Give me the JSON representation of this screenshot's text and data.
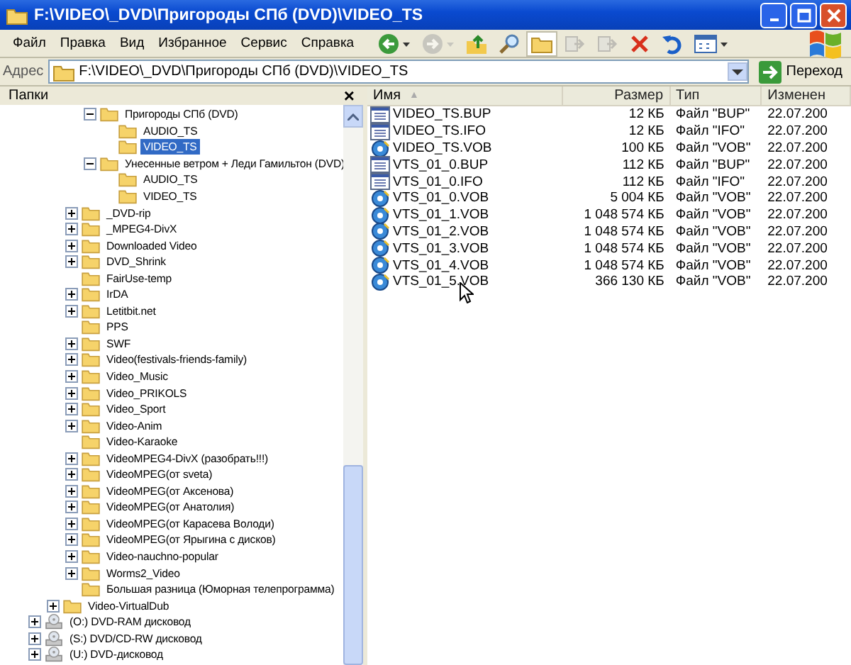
{
  "window": {
    "title": "F:\\VIDEO\\_DVD\\Пригороды СПб (DVD)\\VIDEO_TS"
  },
  "menu": [
    "Файл",
    "Правка",
    "Вид",
    "Избранное",
    "Сервис",
    "Справка"
  ],
  "toolbar": [
    {
      "kind": "back",
      "disabled": false,
      "pressed": false
    },
    {
      "kind": "forward",
      "disabled": true,
      "pressed": false
    },
    {
      "kind": "up",
      "disabled": false,
      "pressed": false
    },
    {
      "kind": "search",
      "disabled": false,
      "pressed": false
    },
    {
      "kind": "folders",
      "disabled": false,
      "pressed": true
    },
    {
      "kind": "move",
      "disabled": true,
      "pressed": false
    },
    {
      "kind": "copy",
      "disabled": true,
      "pressed": false
    },
    {
      "kind": "delete",
      "disabled": false,
      "pressed": false
    },
    {
      "kind": "undo",
      "disabled": false,
      "pressed": false
    },
    {
      "kind": "views",
      "disabled": false,
      "pressed": false
    }
  ],
  "address": {
    "label": "Адрес",
    "value": "F:\\VIDEO\\_DVD\\Пригороды СПб (DVD)\\VIDEO_TS",
    "go": "Переход"
  },
  "folders_pane": {
    "title": "Папки",
    "close": "×",
    "tree": [
      {
        "children": [
          {
            "children": [
              {
                "children": [
                  {
                    "label": "Пригороды СПб (DVD)",
                    "kind": "folder",
                    "expandable": true,
                    "expanded": true,
                    "selected": false,
                    "children": [
                      {
                        "label": "AUDIO_TS",
                        "kind": "folder",
                        "expandable": false,
                        "selected": false
                      },
                      {
                        "label": "VIDEO_TS",
                        "kind": "folder",
                        "expandable": false,
                        "selected": true
                      }
                    ]
                  },
                  {
                    "label": "Унесенные ветром + Леди Гамильтон (DVD)",
                    "kind": "folder",
                    "expandable": true,
                    "expanded": true,
                    "selected": false,
                    "children": [
                      {
                        "label": "AUDIO_TS",
                        "kind": "folder",
                        "expandable": false,
                        "selected": false
                      },
                      {
                        "label": "VIDEO_TS",
                        "kind": "folder",
                        "expandable": false,
                        "selected": false
                      }
                    ]
                  }
                ]
              },
              {
                "label": "_DVD-rip",
                "kind": "folder",
                "expandable": true,
                "expanded": false,
                "selected": false
              },
              {
                "label": "_MPEG4-DivX",
                "kind": "folder",
                "expandable": true,
                "expanded": false,
                "selected": false
              },
              {
                "label": "Downloaded Video",
                "kind": "folder",
                "expandable": true,
                "expanded": false,
                "selected": false
              },
              {
                "label": "DVD_Shrink",
                "kind": "folder",
                "expandable": true,
                "expanded": false,
                "selected": false
              },
              {
                "label": "FairUse-temp",
                "kind": "folder",
                "expandable": false,
                "selected": false
              },
              {
                "label": "IrDA",
                "kind": "folder",
                "expandable": true,
                "expanded": false,
                "selected": false
              },
              {
                "label": "Letitbit.net",
                "kind": "folder",
                "expandable": true,
                "expanded": false,
                "selected": false
              },
              {
                "label": "PPS",
                "kind": "folder",
                "expandable": false,
                "selected": false
              },
              {
                "label": "SWF",
                "kind": "folder",
                "expandable": true,
                "expanded": false,
                "selected": false
              },
              {
                "label": "Video(festivals-friends-family)",
                "kind": "folder",
                "expandable": true,
                "expanded": false,
                "selected": false
              },
              {
                "label": "Video_Music",
                "kind": "folder",
                "expandable": true,
                "expanded": false,
                "selected": false
              },
              {
                "label": "Video_PRIKOLS",
                "kind": "folder",
                "expandable": true,
                "expanded": false,
                "selected": false
              },
              {
                "label": "Video_Sport",
                "kind": "folder",
                "expandable": true,
                "expanded": false,
                "selected": false
              },
              {
                "label": "Video-Anim",
                "kind": "folder",
                "expandable": true,
                "expanded": false,
                "selected": false
              },
              {
                "label": "Video-Karaoke",
                "kind": "folder",
                "expandable": false,
                "selected": false
              },
              {
                "label": "VideoMPEG4-DivX (разобрать!!!)",
                "kind": "folder",
                "expandable": true,
                "expanded": false,
                "selected": false
              },
              {
                "label": "VideoMPEG(от sveta)",
                "kind": "folder",
                "expandable": true,
                "expanded": false,
                "selected": false
              },
              {
                "label": "VideoMPEG(от Аксенова)",
                "kind": "folder",
                "expandable": true,
                "expanded": false,
                "selected": false
              },
              {
                "label": "VideoMPEG(от Анатолия)",
                "kind": "folder",
                "expandable": true,
                "expanded": false,
                "selected": false
              },
              {
                "label": "VideoMPEG(от Карасева Володи)",
                "kind": "folder",
                "expandable": true,
                "expanded": false,
                "selected": false
              },
              {
                "label": "VideoMPEG(от Ярыгина с дисков)",
                "kind": "folder",
                "expandable": true,
                "expanded": false,
                "selected": false
              },
              {
                "label": "Video-nauchno-popular",
                "kind": "folder",
                "expandable": true,
                "expanded": false,
                "selected": false
              },
              {
                "label": "Worms2_Video",
                "kind": "folder",
                "expandable": true,
                "expanded": false,
                "selected": false
              },
              {
                "label": "Большая разница (Юморная телепрограмма)",
                "kind": "folder",
                "expandable": false,
                "selected": false
              }
            ]
          },
          {
            "label": "Video-VirtualDub",
            "kind": "folder",
            "expandable": true,
            "expanded": false,
            "selected": false
          }
        ]
      },
      {
        "label": "(O:) DVD-RAM дисковод",
        "kind": "drive",
        "expandable": true,
        "expanded": false,
        "selected": false
      },
      {
        "label": "(S:) DVD/CD-RW дисковод",
        "kind": "drive",
        "expandable": true,
        "expanded": false,
        "selected": false
      },
      {
        "label": "(U:) DVD-дисковод",
        "kind": "drive",
        "expandable": true,
        "expanded": false,
        "selected": false
      }
    ]
  },
  "file_list": {
    "columns": [
      {
        "label": "Имя",
        "sorted": true
      },
      {
        "label": "Размер",
        "sorted": false
      },
      {
        "label": "Тип",
        "sorted": false
      },
      {
        "label": "Изменен",
        "sorted": false
      }
    ],
    "sort_arrow": "▲",
    "rows": [
      {
        "kind": "data",
        "name": "VIDEO_TS.BUP",
        "size": "12 КБ",
        "type": "Файл \"BUP\"",
        "modified": "22.07.200"
      },
      {
        "kind": "data",
        "name": "VIDEO_TS.IFO",
        "size": "12 КБ",
        "type": "Файл \"IFO\"",
        "modified": "22.07.200"
      },
      {
        "kind": "video",
        "name": "VIDEO_TS.VOB",
        "size": "100 КБ",
        "type": "Файл \"VOB\"",
        "modified": "22.07.200"
      },
      {
        "kind": "data",
        "name": "VTS_01_0.BUP",
        "size": "112 КБ",
        "type": "Файл \"BUP\"",
        "modified": "22.07.200"
      },
      {
        "kind": "data",
        "name": "VTS_01_0.IFO",
        "size": "112 КБ",
        "type": "Файл \"IFO\"",
        "modified": "22.07.200"
      },
      {
        "kind": "video",
        "name": "VTS_01_0.VOB",
        "size": "5 004 КБ",
        "type": "Файл \"VOB\"",
        "modified": "22.07.200"
      },
      {
        "kind": "video",
        "name": "VTS_01_1.VOB",
        "size": "1 048 574 КБ",
        "type": "Файл \"VOB\"",
        "modified": "22.07.200"
      },
      {
        "kind": "video",
        "name": "VTS_01_2.VOB",
        "size": "1 048 574 КБ",
        "type": "Файл \"VOB\"",
        "modified": "22.07.200"
      },
      {
        "kind": "video",
        "name": "VTS_01_3.VOB",
        "size": "1 048 574 КБ",
        "type": "Файл \"VOB\"",
        "modified": "22.07.200"
      },
      {
        "kind": "video",
        "name": "VTS_01_4.VOB",
        "size": "1 048 574 КБ",
        "type": "Файл \"VOB\"",
        "modified": "22.07.200"
      },
      {
        "kind": "video",
        "name": "VTS_01_5.VOB",
        "size": "366 130 КБ",
        "type": "Файл \"VOB\"",
        "modified": "22.07.200"
      }
    ]
  }
}
